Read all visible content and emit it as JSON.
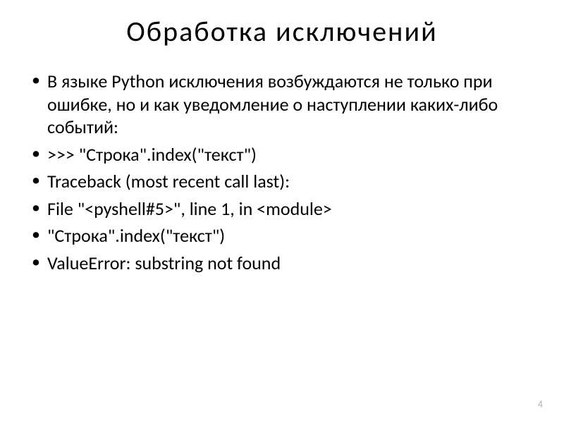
{
  "title": "Обработка  исключений",
  "bullets": [
    {
      "text": "В языке Python исключения возбуждаются не только  при  ошибке,  но  и  как уведомление  о наступлении  каких-либо  событий:",
      "indent": 0
    },
    {
      "text": ">>>  \"Строка\".index(\"текст\")",
      "indent": 0
    },
    {
      "text": "Traceback  (most  recent  call  last):",
      "indent": 0
    },
    {
      "text": "  File  \"<pyshell#5>\",  line  1,  in  <module>",
      "indent": 0
    },
    {
      "text": "     \"Строка\".index(\"текст\")",
      "indent": 0
    },
    {
      "text": "ValueError:  substring  not  found",
      "indent": 0
    }
  ],
  "pageNumber": "4"
}
